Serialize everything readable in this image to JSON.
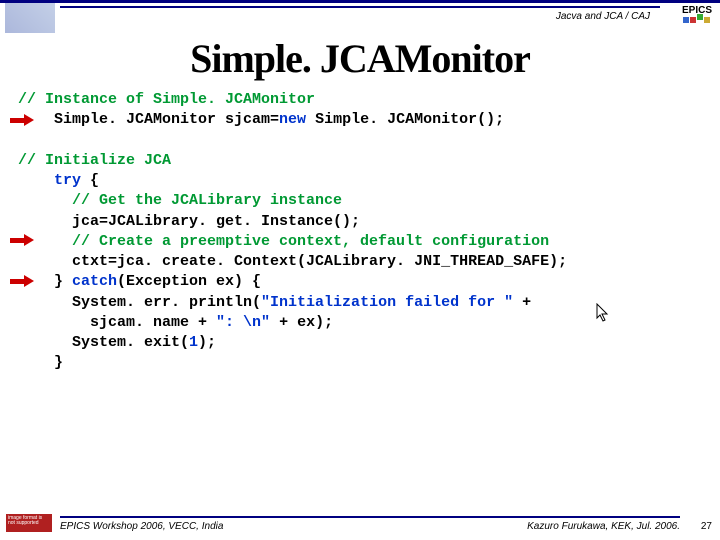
{
  "header": {
    "breadcrumb": "Jacva and JCA / CAJ",
    "logo_text": "EPICS"
  },
  "title": "Simple. JCAMonitor",
  "code": {
    "c1": "// Instance of Simple. JCAMonitor",
    "l2a": "    Simple. JCAMonitor sjcam=",
    "l2_new": "new",
    "l2b": " Simple. JCAMonitor();",
    "blank": " ",
    "c2": "// Initialize JCA",
    "l5_try": "    try",
    "l5b": " {",
    "c3": "      // Get the JCALibrary instance",
    "l7": "      jca=JCALibrary. get. Instance();",
    "c4": "      // Create a preemptive context, default configuration",
    "l9": "      ctxt=jca. create. Context(JCALibrary. JNI_THREAD_SAFE);",
    "l10a": "    } ",
    "l10_catch": "catch",
    "l10b": "(Exception ex) {",
    "l11a": "      System. err. println(",
    "l11_str": "\"Initialization failed for \"",
    "l11b": " +",
    "l12a": "        sjcam. name + ",
    "l12_str": "\": \\n\"",
    "l12b": " + ex);",
    "l13a": "      System. exit(",
    "l13_n": "1",
    "l13b": ");",
    "l14": "    }"
  },
  "footer": {
    "badge": "image format is not supported",
    "left": "EPICS Workshop 2006, VECC, India",
    "right": "Kazuro Furukawa, KEK, Jul. 2006.",
    "page": "27"
  }
}
